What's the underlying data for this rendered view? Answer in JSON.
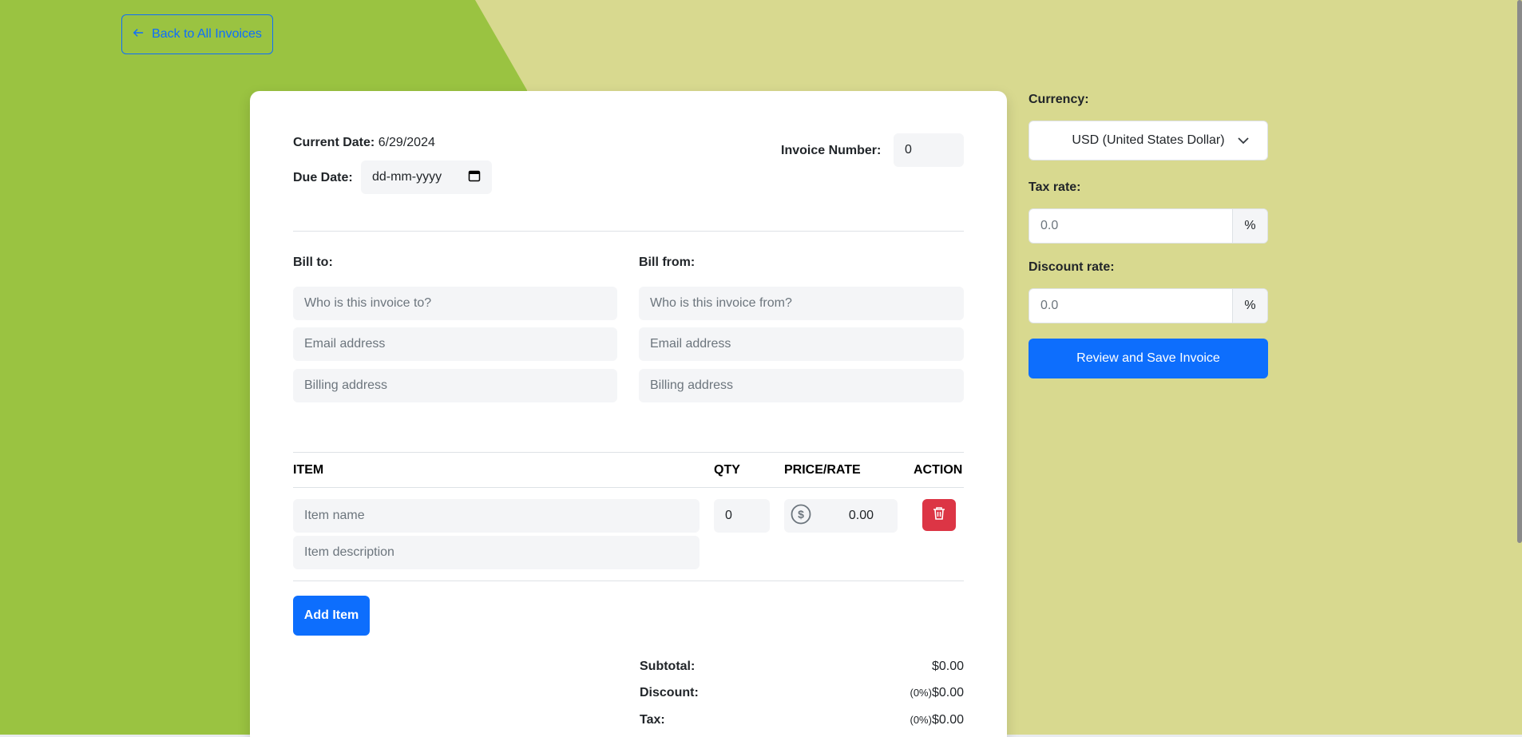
{
  "nav": {
    "back_label": "Back to All Invoices"
  },
  "invoice": {
    "current_date_label": "Current Date:",
    "current_date_value": "6/29/2024",
    "due_date_label": "Due Date:",
    "due_date_placeholder": "dd-mm-yyyy",
    "invoice_number_label": "Invoice Number:",
    "invoice_number_value": "0",
    "bill_to": {
      "label": "Bill to:",
      "name_placeholder": "Who is this invoice to?",
      "email_placeholder": "Email address",
      "address_placeholder": "Billing address"
    },
    "bill_from": {
      "label": "Bill from:",
      "name_placeholder": "Who is this invoice from?",
      "email_placeholder": "Email address",
      "address_placeholder": "Billing address"
    },
    "table": {
      "headers": [
        "ITEM",
        "QTY",
        "PRICE/RATE",
        "ACTION"
      ],
      "rows": [
        {
          "name_placeholder": "Item name",
          "description_placeholder": "Item description",
          "qty": "0",
          "price": "0.00"
        }
      ]
    },
    "add_item_label": "Add Item",
    "summary": {
      "subtotal_label": "Subtotal:",
      "subtotal_value": "$0.00",
      "discount_label": "Discount:",
      "discount_pct": "(0%)",
      "discount_value": "$0.00",
      "tax_label": "Tax:",
      "tax_pct": "(0%)",
      "tax_value": "$0.00"
    }
  },
  "sidebar": {
    "currency_label": "Currency:",
    "currency_value": "USD (United States Dollar)",
    "tax_label": "Tax rate:",
    "tax_placeholder": "0.0",
    "tax_addon": "%",
    "discount_label": "Discount rate:",
    "discount_placeholder": "0.0",
    "discount_addon": "%",
    "review_label": "Review and Save Invoice"
  },
  "colors": {
    "bg_green": "#9ac341",
    "bg_khaki": "#d8d98f",
    "primary": "#0d6efd",
    "danger": "#dc3545"
  },
  "icons": {
    "back": "arrow-left-icon",
    "currency": "dollar-circle-icon",
    "delete": "trash-icon",
    "select": "chevron-down-icon",
    "calendar": "calendar-icon"
  }
}
